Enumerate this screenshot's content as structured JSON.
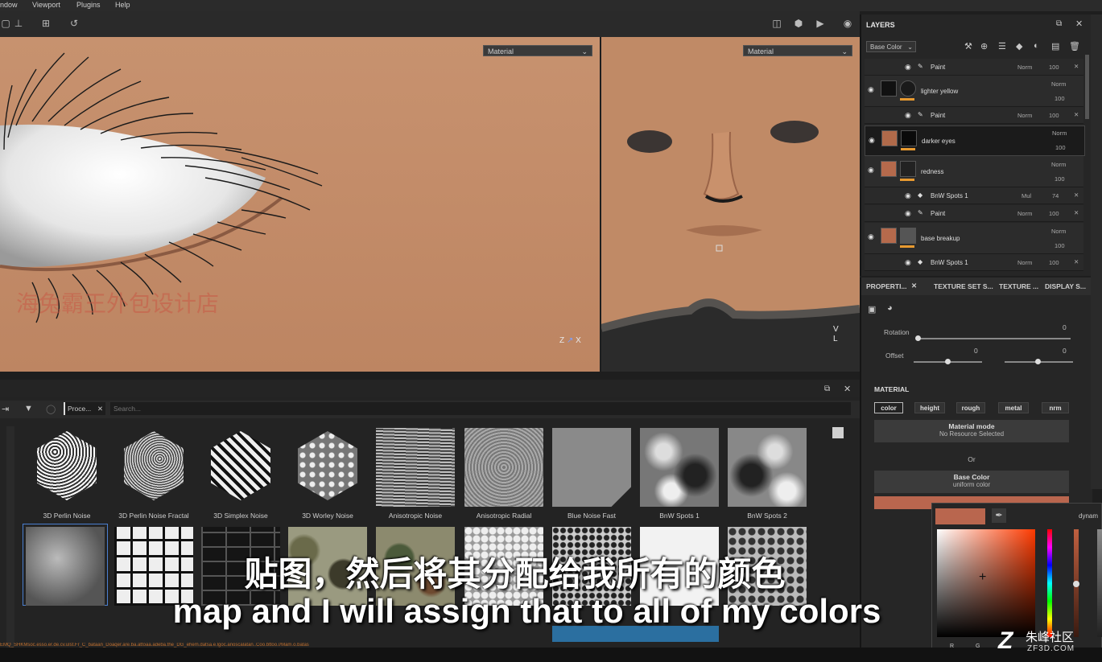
{
  "menu": [
    "ndow",
    "Viewport",
    "Plugins",
    "Help"
  ],
  "viewport_left": {
    "mode": "Material",
    "watermark": "海兔霸王外包设计店",
    "axes": [
      "Z",
      "X"
    ]
  },
  "viewport_right": {
    "mode": "Material",
    "axes": [
      "V",
      "L"
    ]
  },
  "layers": {
    "title": "LAYERS",
    "channel": "Base Color",
    "rows": [
      {
        "kind": "sub",
        "name": "Paint",
        "blend": "Norm",
        "opacity": "100"
      },
      {
        "kind": "layer",
        "name": "lighter yellow",
        "blend": "Norm",
        "opacity": "100",
        "thumb": "#111"
      },
      {
        "kind": "sub",
        "name": "Paint",
        "blend": "Norm",
        "opacity": "100"
      },
      {
        "kind": "layer",
        "name": "darker eyes",
        "blend": "Norm",
        "opacity": "100",
        "thumb": "#b06a4a",
        "selected": true
      },
      {
        "kind": "layer",
        "name": "redness",
        "blend": "Norm",
        "opacity": "100",
        "thumb": "#b56a4c"
      },
      {
        "kind": "sub",
        "name": "BnW Spots 1",
        "blend": "Mul",
        "opacity": "74"
      },
      {
        "kind": "sub",
        "name": "Paint",
        "blend": "Norm",
        "opacity": "100"
      },
      {
        "kind": "layer",
        "name": "base breakup",
        "blend": "Norm",
        "opacity": "100",
        "thumb": "#b56a4c"
      },
      {
        "kind": "sub",
        "name": "BnW Spots 1",
        "blend": "Norm",
        "opacity": "100"
      }
    ]
  },
  "properties": {
    "tabs": [
      "PROPERTI...",
      "TEXTURE SET S...",
      "TEXTURE ...",
      "DISPLAY S..."
    ],
    "rotation_label": "Rotation",
    "rotation_value": "0",
    "offset_label": "Offset",
    "offset_x": "0",
    "offset_y": "0",
    "material_heading": "MATERIAL",
    "channels": [
      "color",
      "height",
      "rough",
      "metal",
      "nrm"
    ],
    "material_mode_title": "Material mode",
    "material_mode_value": "No Resource Selected",
    "or_text": "Or",
    "base_color_title": "Base Color",
    "base_color_value": "uniform color",
    "swatch_color": "#b9664e"
  },
  "shelf": {
    "tab_label": "Proce...",
    "search_placeholder": "Search...",
    "row1": [
      "3D Perlin Noise",
      "3D Perlin Noise Fractal",
      "3D Simplex Noise",
      "3D Worley Noise",
      "Anisotropic Noise",
      "Anisotropic Radial",
      "Blue Noise Fast",
      "BnW Spots 1",
      "BnW Spots 2"
    ]
  },
  "subtitles": {
    "cn": "贴图，然后将其分配给我所有的颜色",
    "en": "map and I will assign that to all of my colors"
  },
  "color_picker": {
    "mode": "dynam",
    "channel_r": "R",
    "channel_g": "G"
  },
  "brand": {
    "name": "朱峰社区",
    "url": "ZF3D.COM"
  },
  "log_text": "EMQ_SHKMsoc.esso.er.de.cv.ulst.Fr_C_bataan_Doaqer.are.ba.attoaa.adeba.the_DG_ehem.datsa.e.lgoc.anoscalatan..Coo.bttoo.//Mam.o.batas"
}
